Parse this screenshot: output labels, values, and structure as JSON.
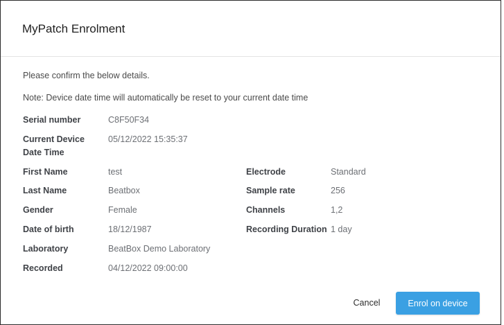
{
  "dialog": {
    "title": "MyPatch Enrolment",
    "confirm_text": "Please confirm the below details.",
    "note_text": "Note: Device date time will automatically be reset to your current date time"
  },
  "device": {
    "serial_label": "Serial number",
    "serial_value": "C8F50F34",
    "datetime_label_line1": "Current Device",
    "datetime_label_line2": "Date Time",
    "datetime_value": "05/12/2022 15:35:37"
  },
  "patient": {
    "first_name_label": "First Name",
    "first_name_value": "test",
    "last_name_label": "Last Name",
    "last_name_value": "Beatbox",
    "gender_label": "Gender",
    "gender_value": "Female",
    "dob_label": "Date of birth",
    "dob_value": "18/12/1987",
    "laboratory_label": "Laboratory",
    "laboratory_value": "BeatBox Demo Laboratory",
    "recorded_label": "Recorded",
    "recorded_value": "04/12/2022 09:00:00"
  },
  "recording": {
    "electrode_label": "Electrode",
    "electrode_value": "Standard",
    "sample_rate_label": "Sample rate",
    "sample_rate_value": "256",
    "channels_label": "Channels",
    "channels_value": "1,2",
    "duration_label": "Recording Duration",
    "duration_value": "1 day"
  },
  "footer": {
    "cancel_label": "Cancel",
    "enrol_label": "Enrol on device"
  },
  "colors": {
    "primary_button": "#3aa0e3",
    "border": "#2b2b2b"
  }
}
